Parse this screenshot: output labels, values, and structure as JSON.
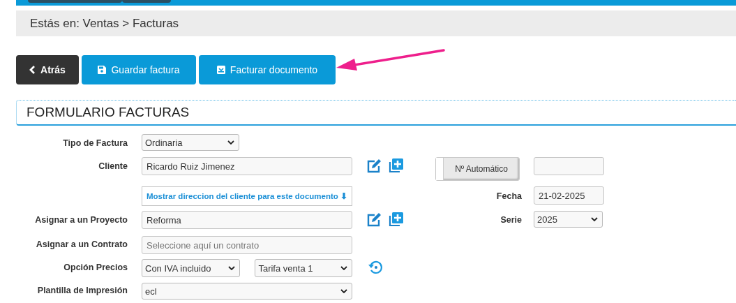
{
  "breadcrumb": "Estás en: Ventas > Facturas",
  "buttons": [
    {
      "kind": "back",
      "label": "Atrás"
    },
    {
      "kind": "save",
      "label": "Guardar factura"
    },
    {
      "kind": "invoice",
      "label": "Facturar documento"
    }
  ],
  "form": {
    "title": "FORMULARIO FACTURAS",
    "tipo": {
      "label": "Tipo de Factura",
      "value": "Ordinaria"
    },
    "cliente": {
      "label": "Cliente",
      "value": "Ricardo Ruiz Jimenez"
    },
    "auto_number": {
      "label": "Nº Automático",
      "on": false
    },
    "address_link": {
      "label": "Mostrar direccion del cliente para este documento ⬇"
    },
    "fecha": {
      "label": "Fecha",
      "value": "21-02-2025"
    },
    "proyecto": {
      "label": "Asignar a un Proyecto",
      "value": "Reforma"
    },
    "serie": {
      "label": "Serie",
      "value": "2025"
    },
    "contrato": {
      "label": "Asignar a un Contrato",
      "placeholder": "Seleccione aquí un contrato"
    },
    "precios": {
      "label": "Opción Precios",
      "iva": "Con IVA incluido",
      "tarifa": "Tarifa venta 1"
    },
    "plantilla": {
      "label": "Plantilla de Impresión",
      "value": "ecl"
    }
  }
}
